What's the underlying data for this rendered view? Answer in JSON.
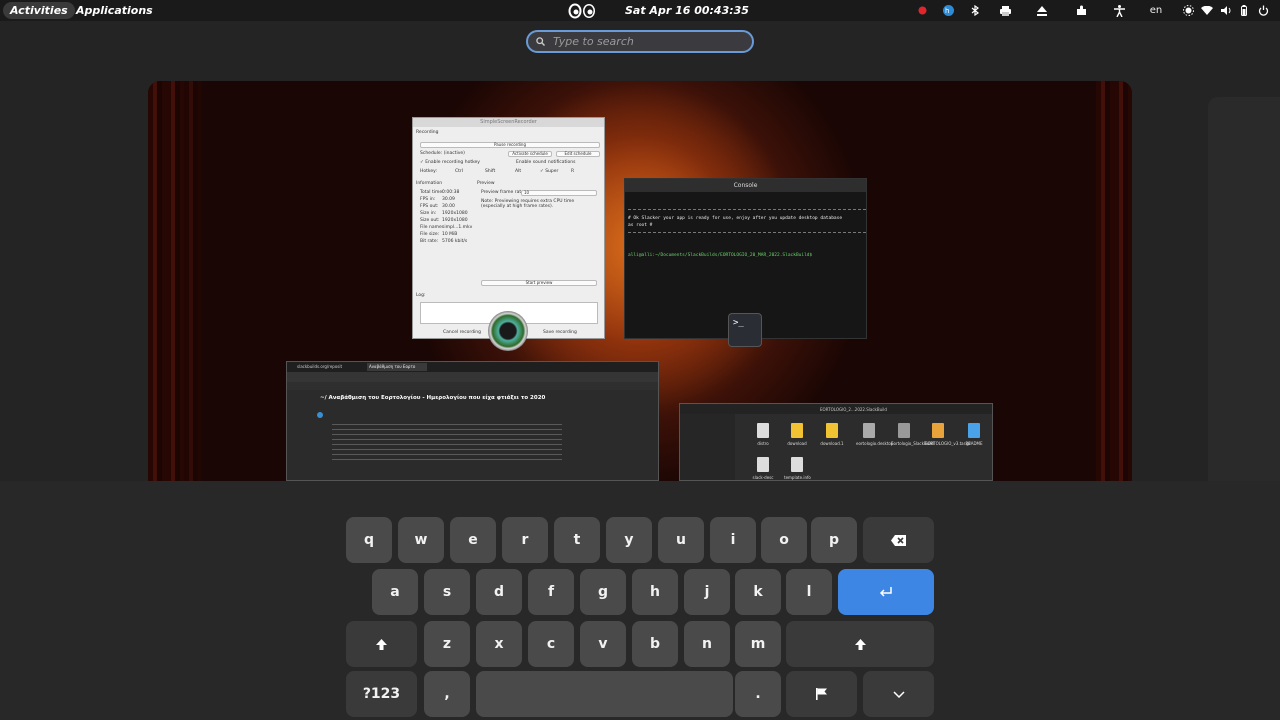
{
  "topbar": {
    "activities": "Activities",
    "applications": "Applications",
    "clock": "Sat Apr 16  00:43:35",
    "language": "en"
  },
  "search": {
    "placeholder": "Type to search"
  },
  "windows": {
    "recorder": {
      "title": "SimpleScreenRecorder",
      "recording": "Recording",
      "pause": "Pause recording",
      "schedule": "Schedule: (inactive)",
      "activate": "Activate schedule",
      "edit": "Edit schedule",
      "hotkey_enable": "✓ Enable recording hotkey",
      "sound": "Enable sound notifications",
      "hotkey": "Hotkey:",
      "ctrl": "Ctrl",
      "shift": "Shift",
      "alt": "Alt",
      "super": "✓ Super",
      "key_r": "R",
      "information": "Information",
      "preview": "Preview",
      "total_time": "Total time:",
      "total_time_v": "0:00:38",
      "fps_in": "FPS in:",
      "fps_in_v": "30.09",
      "fps_out": "FPS out:",
      "fps_out_v": "30.00",
      "size_in": "Size in:",
      "size_in_v": "1920x1080",
      "size_out": "Size out:",
      "size_out_v": "1920x1080",
      "file_name": "File name:",
      "file_name_v": "simpl...1.mkv",
      "file_size": "File size:",
      "file_size_v": "10 MiB",
      "bit_rate": "Bit rate:",
      "bit_rate_v": "5706 kbit/s",
      "frame_rate": "Preview frame rate:",
      "frame_rate_v": "10",
      "note": "Note: Previewing requires extra CPU time (especially at high frame rates).",
      "start_preview": "Start preview",
      "log": "Log:",
      "cancel": "Cancel recording",
      "save": "Save recording"
    },
    "console": {
      "title": "Console",
      "line1": "# Ok Slacker your app is ready for use, enjoy after you update desktop database",
      "line2": "as root #",
      "prompt": "alli@alli:~/Documents/SlackBuilds/EORTOLOGIO_20_MAR_2022.SlackBuild$"
    },
    "browser": {
      "tab1": "slackbuilds.org/reposit",
      "tab2": "Αναβάθμιση του Εορτο",
      "heading": "~/ Αναβάθμιση του Εορτολογίου - Ημερολογίου που είχα φτιάξει το 2020"
    },
    "files": {
      "path": "EORTOLOGIO_2...2022.SlackBuild",
      "items": [
        "distro",
        "download",
        "download.1",
        "eortologio.desktop",
        "Eortologio_SlackBuild",
        "EORTOLOGIO_v3.tar.gz",
        "README",
        "slack-desc",
        "template.info"
      ]
    }
  },
  "terminal_icon": ">_",
  "keyboard": {
    "row1": [
      "q",
      "w",
      "e",
      "r",
      "t",
      "y",
      "u",
      "i",
      "o",
      "p"
    ],
    "row2": [
      "a",
      "s",
      "d",
      "f",
      "g",
      "h",
      "j",
      "k",
      "l"
    ],
    "row3": [
      "z",
      "x",
      "c",
      "v",
      "b",
      "n",
      "m"
    ],
    "numbers": "?123",
    "comma": ",",
    "period": ".",
    "backspace_icon": "backspace-icon",
    "enter_icon": "enter-icon",
    "shift_icon": "shift-icon",
    "emoji_icon": "flag-icon",
    "hide_icon": "chevron-down-icon"
  }
}
